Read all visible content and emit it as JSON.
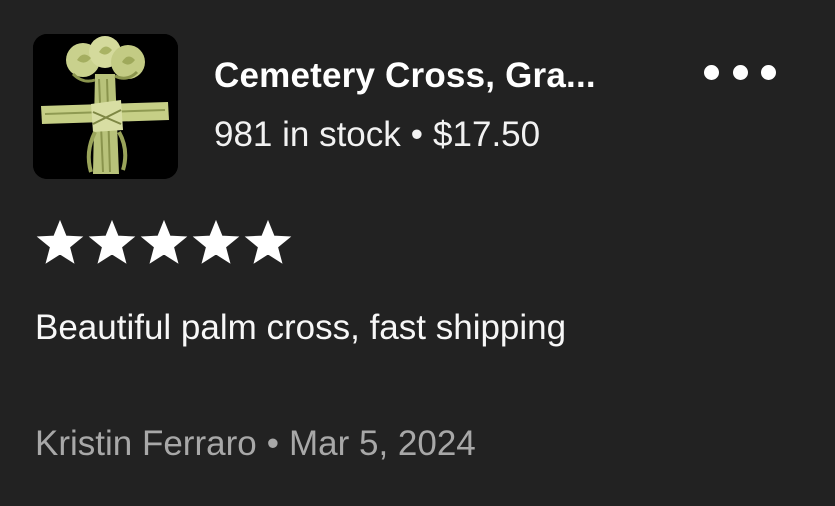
{
  "listing": {
    "title": "Cemetery Cross, Gra...",
    "stock": "981 in stock",
    "separator": "•",
    "price": "$17.50",
    "thumbnail_icon": "palm-cross-image"
  },
  "menu": {
    "icon": "more-options-icon"
  },
  "review": {
    "rating": 5,
    "rating_max": 5,
    "text": "Beautiful palm cross, fast shipping",
    "author": "Kristin Ferraro",
    "date": "Mar 5, 2024"
  },
  "colors": {
    "background": "#222222",
    "text": "#ffffff",
    "muted": "#a8a8a8",
    "star": "#ffffff"
  }
}
